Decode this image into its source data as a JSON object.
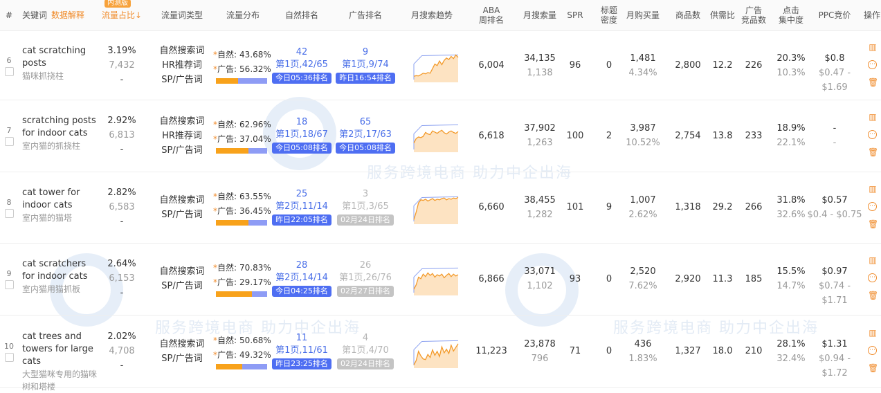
{
  "columns": {
    "index": "#",
    "keyword": "关键词",
    "explain": "数据解释",
    "share": "流量占比",
    "share_sort": "↓",
    "beta_badge": "内测版",
    "type": "流量词类型",
    "dist": "流量分布",
    "organic": "自然排名",
    "ad": "广告排名",
    "trend": "月搜索趋势",
    "aba_l1": "ABA",
    "aba_l2": "周排名",
    "search": "月搜索量",
    "spr": "SPR",
    "title_l1": "标题",
    "title_l2": "密度",
    "buy": "月购买量",
    "products": "商品数",
    "supply": "供需比",
    "ad_l1": "广告",
    "ad_l2": "竞品数",
    "click_l1": "点击",
    "click_l2": "集中度",
    "ppc": "PPC竞价",
    "ops": "操作"
  },
  "watermark": {
    "text": "服务跨境电商 助力中企出海"
  },
  "dist_labels": {
    "natural": "自然:",
    "ad": "广告:"
  },
  "rows": [
    {
      "index": "6",
      "keyword_en": "cat scratching posts",
      "keyword_zh": "猫咪抓挠柱",
      "share_pct": "3.19%",
      "share_val": "7,432",
      "share_extra": "-",
      "types": [
        "自然搜索词",
        "HR推荐词",
        "SP/广告词"
      ],
      "natural_pct": "43.68%",
      "ad_pct": "56.32%",
      "natural_frac": 0.4368,
      "organic_rank": "42",
      "organic_page": "第1页,42/65",
      "organic_tag": "今日05:36排名",
      "organic_grey": false,
      "ad_rank": "9",
      "ad_page": "第1页,9/74",
      "ad_tag": "昨日16:54排名",
      "ad_grey": false,
      "trend": [
        20,
        22,
        21,
        25,
        30,
        28,
        32,
        30,
        45,
        60,
        55,
        70,
        58,
        72,
        80,
        75,
        85,
        78,
        90,
        82
      ],
      "aba": "6,004",
      "search": "34,135",
      "search_sub": "1,138",
      "spr": "96",
      "title_density": "0",
      "buy": "1,481",
      "buy_rate": "4.34%",
      "products": "2,800",
      "supply": "12.2",
      "ad_competitors": "226",
      "click_conc": "20.3%",
      "click_conc_sub": "10.3%",
      "ppc": "$0.8",
      "ppc_range": "$0.47 - $1.69"
    },
    {
      "index": "7",
      "keyword_en": "scratching posts for indoor cats",
      "keyword_zh": "室内猫的抓挠柱",
      "share_pct": "2.92%",
      "share_val": "6,813",
      "share_extra": "-",
      "types": [
        "自然搜索词",
        "HR推荐词",
        "SP/广告词"
      ],
      "natural_pct": "62.96%",
      "ad_pct": "37.04%",
      "natural_frac": 0.6296,
      "organic_rank": "18",
      "organic_page": "第1页,18/67",
      "organic_tag": "今日05:08排名",
      "organic_grey": false,
      "ad_rank": "65",
      "ad_page": "第2页,17/63",
      "ad_tag": "今日05:08排名",
      "ad_grey": false,
      "trend": [
        30,
        45,
        50,
        48,
        52,
        65,
        60,
        58,
        70,
        66,
        62,
        68,
        72,
        64,
        60,
        66,
        70,
        65,
        62,
        68
      ],
      "aba": "6,618",
      "search": "37,902",
      "search_sub": "1,263",
      "spr": "100",
      "title_density": "2",
      "buy": "3,987",
      "buy_rate": "10.52%",
      "products": "2,754",
      "supply": "13.8",
      "ad_competitors": "233",
      "click_conc": "18.9%",
      "click_conc_sub": "22.1%",
      "ppc": "-",
      "ppc_range": "-"
    },
    {
      "index": "8",
      "keyword_en": "cat tower for indoor cats",
      "keyword_zh": "室内猫的猫塔",
      "share_pct": "2.82%",
      "share_val": "6,583",
      "share_extra": "-",
      "types": [
        "自然搜索词",
        "SP/广告词"
      ],
      "natural_pct": "63.55%",
      "ad_pct": "36.45%",
      "natural_frac": 0.6355,
      "organic_rank": "25",
      "organic_page": "第2页,11/14",
      "organic_tag": "昨日22:05排名",
      "organic_grey": false,
      "ad_rank": "3",
      "ad_page": "第1页,3/65",
      "ad_tag": "02月24日排名",
      "ad_grey": true,
      "trend": [
        15,
        40,
        70,
        80,
        78,
        82,
        76,
        80,
        84,
        78,
        82,
        80,
        84,
        86,
        80,
        84,
        82,
        86,
        84,
        88
      ],
      "aba": "6,660",
      "search": "38,455",
      "search_sub": "1,282",
      "spr": "101",
      "title_density": "9",
      "buy": "1,007",
      "buy_rate": "2.62%",
      "products": "1,318",
      "supply": "29.2",
      "ad_competitors": "266",
      "click_conc": "31.8%",
      "click_conc_sub": "32.6%",
      "ppc": "$0.57",
      "ppc_range": "$0.4 - $0.75"
    },
    {
      "index": "9",
      "keyword_en": "cat scratchers for indoor cats",
      "keyword_zh": "室内猫用猫抓板",
      "share_pct": "2.64%",
      "share_val": "6,153",
      "share_extra": "-",
      "types": [
        "自然搜索词",
        "SP/广告词"
      ],
      "natural_pct": "70.83%",
      "ad_pct": "29.17%",
      "natural_frac": 0.7083,
      "organic_rank": "28",
      "organic_page": "第2页,14/14",
      "organic_tag": "今日04:25排名",
      "organic_grey": false,
      "ad_rank": "26",
      "ad_page": "第1页,26/76",
      "ad_tag": "02月27日排名",
      "ad_grey": true,
      "trend": [
        20,
        35,
        60,
        55,
        70,
        62,
        74,
        66,
        72,
        60,
        68,
        64,
        70,
        58,
        66,
        72,
        62,
        70,
        64,
        68
      ],
      "aba": "6,866",
      "search": "33,071",
      "search_sub": "1,102",
      "spr": "93",
      "title_density": "0",
      "buy": "2,520",
      "buy_rate": "7.62%",
      "products": "2,920",
      "supply": "11.3",
      "ad_competitors": "185",
      "click_conc": "15.5%",
      "click_conc_sub": "14.7%",
      "ppc": "$0.97",
      "ppc_range": "$0.74 - $1.71"
    },
    {
      "index": "10",
      "keyword_en": "cat trees and towers for large cats",
      "keyword_zh": "大型猫咪专用的猫咪树和塔楼",
      "share_pct": "2.02%",
      "share_val": "4,708",
      "share_extra": "-",
      "types": [
        "自然搜索词",
        "SP/广告词"
      ],
      "natural_pct": "50.68%",
      "ad_pct": "49.32%",
      "natural_frac": 0.5068,
      "organic_rank": "11",
      "organic_page": "第1页,11/61",
      "organic_tag": "昨日23:25排名",
      "organic_grey": false,
      "ad_rank": "4",
      "ad_page": "第1页,4/70",
      "ad_tag": "02月24日排名",
      "ad_grey": true,
      "trend": [
        10,
        25,
        55,
        40,
        30,
        28,
        45,
        35,
        60,
        42,
        55,
        38,
        70,
        50,
        62,
        48,
        75,
        56,
        68,
        80
      ],
      "aba": "11,223",
      "search": "23,878",
      "search_sub": "796",
      "spr": "71",
      "title_density": "0",
      "buy": "436",
      "buy_rate": "1.83%",
      "products": "1,327",
      "supply": "18.0",
      "ad_competitors": "210",
      "click_conc": "28.1%",
      "click_conc_sub": "32.4%",
      "ppc": "$1.31",
      "ppc_range": "$0.94 - $1.72"
    }
  ]
}
